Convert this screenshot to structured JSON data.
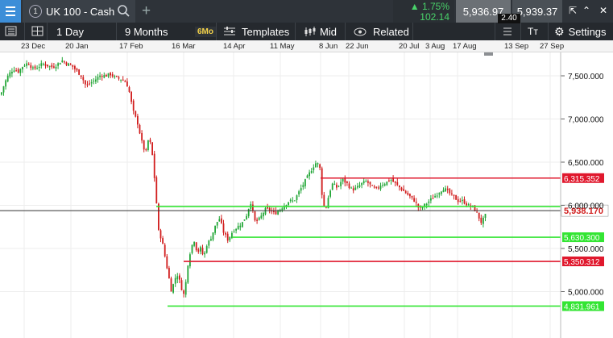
{
  "topbar": {
    "instrument_number": "1",
    "instrument_name": "UK 100 - Cash",
    "change_percent": "▲ 1.75%",
    "change_points": "102.14",
    "sell_price": "5,936.97",
    "buy_price": "5,939.37",
    "spread": "2.40"
  },
  "toolbar": {
    "interval": "1 Day",
    "range": "9 Months",
    "range_badge": "6Mo",
    "templates": "Templates",
    "price_type": "Mid",
    "related": "Related",
    "text_tool": "Tт",
    "settings": "Settings"
  },
  "date_labels": [
    "23 Dec",
    "20 Jan",
    "17 Feb",
    "16 Mar",
    "14 Apr",
    "11 May",
    "8 Jun",
    "22 Jun",
    "20 Jul",
    "3 Aug",
    "17 Aug",
    "13 Sep",
    "27 Sep"
  ],
  "chart_data": {
    "type": "candlestick",
    "instrument": "UK 100 - Cash",
    "y_ticks": [
      7500,
      7000,
      6500,
      6000,
      5500,
      5000
    ],
    "y_tick_labels": [
      "7,500.000",
      "7,000.000",
      "6,500.000",
      "6,000.000",
      "5,500.000",
      "5,000.000"
    ],
    "ylim": [
      4770,
      7900
    ],
    "current_price": 5938.17,
    "current_price_label": "5,938.170",
    "horizontal_lines": [
      {
        "value": 6315.352,
        "label": "6,315.352",
        "color": "#e0182d"
      },
      {
        "value": 5985.0,
        "label": "",
        "color": "#33e533"
      },
      {
        "value": 5630.3,
        "label": "5,630.300",
        "color": "#33e533"
      },
      {
        "value": 5350.312,
        "label": "5,350.312",
        "color": "#e0182d"
      },
      {
        "value": 4831.961,
        "label": "4,831.961",
        "color": "#33e533"
      }
    ],
    "close_path": [
      [
        0,
        7280
      ],
      [
        5,
        7420
      ],
      [
        10,
        7520
      ],
      [
        16,
        7580
      ],
      [
        22,
        7550
      ],
      [
        28,
        7620
      ],
      [
        34,
        7650
      ],
      [
        40,
        7580
      ],
      [
        46,
        7600
      ],
      [
        52,
        7640
      ],
      [
        58,
        7620
      ],
      [
        64,
        7600
      ],
      [
        70,
        7630
      ],
      [
        76,
        7680
      ],
      [
        82,
        7640
      ],
      [
        88,
        7620
      ],
      [
        94,
        7560
      ],
      [
        100,
        7500
      ],
      [
        106,
        7380
      ],
      [
        112,
        7420
      ],
      [
        118,
        7460
      ],
      [
        124,
        7510
      ],
      [
        130,
        7500
      ],
      [
        136,
        7520
      ],
      [
        142,
        7480
      ],
      [
        150,
        7460
      ],
      [
        156,
        7420
      ],
      [
        160,
        7300
      ],
      [
        164,
        7100
      ],
      [
        170,
        6950
      ],
      [
        176,
        6700
      ],
      [
        180,
        6600
      ],
      [
        184,
        6800
      ],
      [
        188,
        6600
      ],
      [
        192,
        6200
      ],
      [
        196,
        5700
      ],
      [
        200,
        5600
      ],
      [
        204,
        5400
      ],
      [
        208,
        5200
      ],
      [
        212,
        5000
      ],
      [
        216,
        5150
      ],
      [
        220,
        5200
      ],
      [
        224,
        5050
      ],
      [
        228,
        4950
      ],
      [
        232,
        5300
      ],
      [
        236,
        5500
      ],
      [
        240,
        5600
      ],
      [
        244,
        5450
      ],
      [
        248,
        5500
      ],
      [
        252,
        5400
      ],
      [
        256,
        5550
      ],
      [
        260,
        5600
      ],
      [
        264,
        5700
      ],
      [
        268,
        5800
      ],
      [
        272,
        5850
      ],
      [
        276,
        5700
      ],
      [
        282,
        5600
      ],
      [
        288,
        5700
      ],
      [
        294,
        5750
      ],
      [
        300,
        5800
      ],
      [
        306,
        5900
      ],
      [
        310,
        6050
      ],
      [
        316,
        5800
      ],
      [
        322,
        5850
      ],
      [
        328,
        5950
      ],
      [
        334,
        5950
      ],
      [
        340,
        5900
      ],
      [
        346,
        5950
      ],
      [
        352,
        6000
      ],
      [
        358,
        6050
      ],
      [
        364,
        6050
      ],
      [
        370,
        6150
      ],
      [
        376,
        6250
      ],
      [
        382,
        6350
      ],
      [
        388,
        6450
      ],
      [
        392,
        6500
      ],
      [
        396,
        6450
      ],
      [
        400,
        6000
      ],
      [
        404,
        5980
      ],
      [
        408,
        6150
      ],
      [
        412,
        6250
      ],
      [
        418,
        6200
      ],
      [
        424,
        6300
      ],
      [
        430,
        6250
      ],
      [
        436,
        6180
      ],
      [
        442,
        6200
      ],
      [
        448,
        6250
      ],
      [
        454,
        6280
      ],
      [
        460,
        6220
      ],
      [
        466,
        6180
      ],
      [
        472,
        6240
      ],
      [
        478,
        6260
      ],
      [
        484,
        6300
      ],
      [
        490,
        6250
      ],
      [
        496,
        6200
      ],
      [
        502,
        6150
      ],
      [
        508,
        6100
      ],
      [
        514,
        6050
      ],
      [
        520,
        5950
      ],
      [
        526,
        6000
      ],
      [
        532,
        6050
      ],
      [
        538,
        6100
      ],
      [
        544,
        6150
      ],
      [
        550,
        6200
      ],
      [
        556,
        6150
      ],
      [
        562,
        6100
      ],
      [
        568,
        6050
      ],
      [
        574,
        6050
      ],
      [
        580,
        6000
      ],
      [
        586,
        5980
      ],
      [
        592,
        5900
      ],
      [
        596,
        5800
      ],
      [
        600,
        5850
      ],
      [
        604,
        5930
      ]
    ],
    "grid": true
  }
}
